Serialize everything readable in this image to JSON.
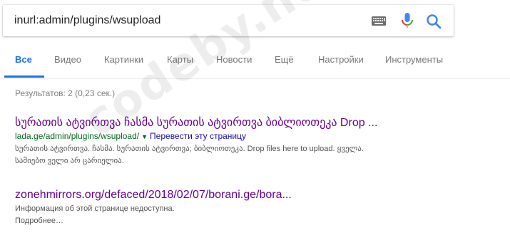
{
  "search": {
    "query": "inurl:admin/plugins/wsupload"
  },
  "icons": {
    "keyboard": "keyboard-icon",
    "mic": "microphone-icon",
    "search": "search-icon"
  },
  "tabs": [
    {
      "label": "Все",
      "active": true
    },
    {
      "label": "Видео"
    },
    {
      "label": "Картинки"
    },
    {
      "label": "Карты"
    },
    {
      "label": "Новости"
    },
    {
      "label": "Ещё"
    },
    {
      "label": "Настройки"
    },
    {
      "label": "Инструменты"
    }
  ],
  "stats": "Результатов: 2 (0,23 сек.)",
  "results": [
    {
      "title": "სურათის ატვირთვა ჩასმა სურათის ატვირთვა ბიბლიოთეკა Drop ...",
      "url": "lada.ge/admin/plugins/wsupload/",
      "translate": "Перевести эту страницу",
      "snippet_line1": "სურათის ატვირთვა. ჩასმა. სურათის ატვირთვა; ბიბლიოთეკა. Drop files here to upload. ყველა.",
      "snippet_line2": "სამიებო ველი არ ცარიელია."
    },
    {
      "title": "zonehmirrors.org/defaced/2018/02/07/borani.ge/bora...",
      "snippet_line1": "Информация об этой странице недоступна.",
      "snippet_line2": "Подробнее…"
    }
  ],
  "watermark": "codeby.net",
  "colors": {
    "accent": "#1a73e8",
    "visited_link": "#660099",
    "url_green": "#006621",
    "link_blue": "#1a0dab"
  }
}
